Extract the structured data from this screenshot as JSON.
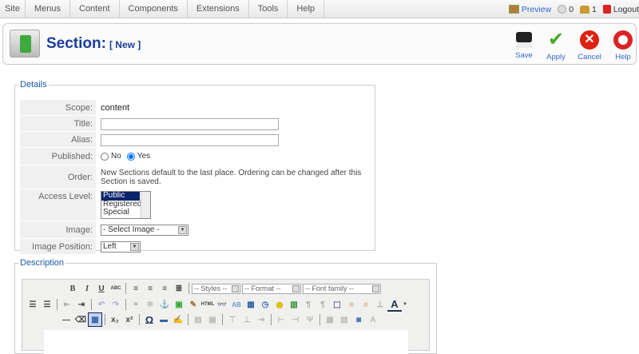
{
  "menu": {
    "items": [
      "Site",
      "Menus",
      "Content",
      "Components",
      "Extensions",
      "Tools",
      "Help"
    ]
  },
  "status": {
    "preview": "Preview",
    "messages": "0",
    "users": "1",
    "logout": "Logout"
  },
  "header": {
    "title": "Section:",
    "subtitle": "[ New ]"
  },
  "toolbar": {
    "save": "Save",
    "apply": "Apply",
    "cancel": "Cancel",
    "help": "Help"
  },
  "details": {
    "legend": "Details",
    "scope_label": "Scope:",
    "scope_value": "content",
    "title_label": "Title:",
    "title_value": "",
    "alias_label": "Alias:",
    "alias_value": "",
    "published_label": "Published:",
    "published_no": "No",
    "published_yes": "Yes",
    "order_label": "Order:",
    "order_text": "New Sections default to the last place. Ordering can be changed after this Section is saved.",
    "access_label": "Access Level:",
    "access_options": [
      "Public",
      "Registered",
      "Special"
    ],
    "image_label": "Image:",
    "image_value": "- Select Image -",
    "position_label": "Image Position:",
    "position_value": "Left"
  },
  "description": {
    "legend": "Description",
    "styles": "-- Styles --",
    "format": "-- Format --",
    "font_family": "-- Font family --"
  },
  "colors": {
    "accent": "#1a3d9c",
    "link": "#3366cc"
  }
}
